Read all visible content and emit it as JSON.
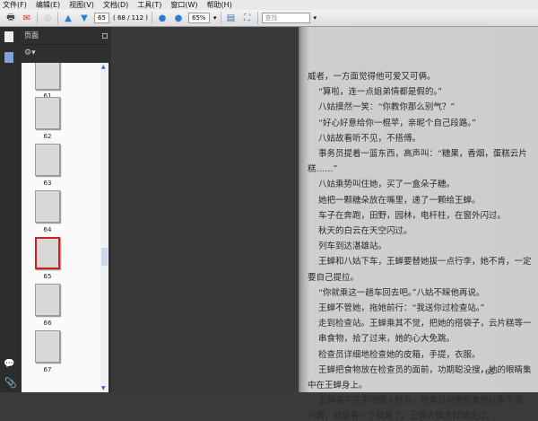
{
  "menu": [
    "文件(F)",
    "编辑(E)",
    "视图(V)",
    "文档(D)",
    "工具(T)",
    "窗口(W)",
    "帮助(H)"
  ],
  "toolbar": {
    "page_value": "65",
    "page_count": "( 68 / 112 )",
    "zoom_value": "65%",
    "search_placeholder": "查找"
  },
  "panel": {
    "title": "页面"
  },
  "thumbnails": [
    {
      "label": "61"
    },
    {
      "label": "62"
    },
    {
      "label": "63"
    },
    {
      "label": "64"
    },
    {
      "label": "65",
      "selected": true
    },
    {
      "label": "66"
    },
    {
      "label": "67"
    }
  ],
  "page_lines": [
    "威者，一方面觉得他可爱又可俩。",
    "“算啦，连一点姐弟情都是假的。”",
    "八姑摸然一笑：“你教你那么别气？”",
    "“好心好意给你一棍苹，亲昵个自己段路。”",
    "八姑故看听不见，不搭傅。",
    "事务员提着一篮东西，高声叫：“糖果，香烟，蛋糕云片",
    "糕……”",
    "八姑乘势叫住她，买了一盒朵子糖。",
    "她把一颗糖朵放在嘴里，递了一颗给王蝉。",
    "车子在奔跑，田野，园林，电杆柱，在窗外闪过。",
    "秋天的白云在天空闪过。",
    "列车到达湛雄站。",
    "王蝉和八姑下车，王蝉要替她拔一点行李，她不肯，一定",
    "要自己提拉。",
    "“你就乘这一趟车回去吧。”八姑不睬他再说。",
    "王蝉不管她，拖她前行：“我送你过检查站。”",
    "走到检查站。王蝉乘其不觉，把她的搭袋子，云片糕等一",
    "串食物，拾了过来，她的心大免跳。",
    "检查员详细地检查她的皮箱，手提，衣服。",
    "王蝉把食物放在检查员的面前，功期聪没搜，她的眼睛集",
    "中在王蝉身上。",
    "王蝉毫不在乎地跟人检查。检查员对那些食物好象不感",
    "兴趣，随便看一下就算了。王蝉大模大样地走过。",
    "· 65 ·"
  ]
}
